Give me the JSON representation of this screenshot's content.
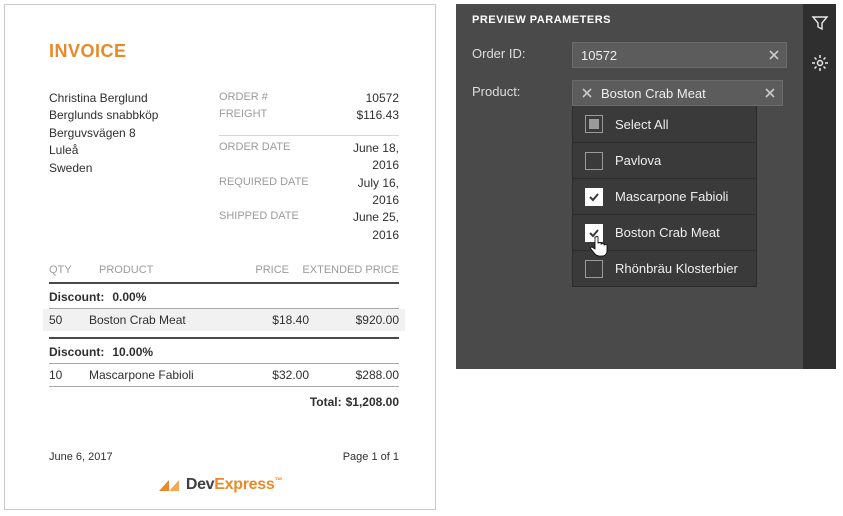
{
  "invoice": {
    "title": "INVOICE",
    "customer": {
      "name": "Christina Berglund",
      "company": "Berglunds snabbköp",
      "street": "Berguvsvägen 8",
      "city": "Luleå",
      "country": "Sweden"
    },
    "meta1": {
      "order_lbl": "ORDER #",
      "order_val": "10572",
      "freight_lbl": "FREIGHT",
      "freight_val": "$116.43"
    },
    "meta2": {
      "orderdate_lbl": "ORDER DATE",
      "orderdate_val": "June 18, 2016",
      "reqdate_lbl": "REQUIRED DATE",
      "reqdate_val": "July 16, 2016",
      "shipdate_lbl": "SHIPPED DATE",
      "shipdate_val": "June 25, 2016"
    },
    "cols": {
      "qty": "QTY",
      "product": "PRODUCT",
      "price": "PRICE",
      "ext": "EXTENDED PRICE"
    },
    "groups": [
      {
        "discount_label": "Discount:",
        "discount_val": "0.00%",
        "rows": [
          {
            "qty": "50",
            "name": "Boston Crab Meat",
            "price": "$18.40",
            "ext": "$920.00",
            "shaded": true
          }
        ]
      },
      {
        "discount_label": "Discount:",
        "discount_val": "10.00%",
        "rows": [
          {
            "qty": "10",
            "name": "Mascarpone Fabioli",
            "price": "$32.00",
            "ext": "$288.00"
          }
        ]
      }
    ],
    "total_label": "Total:",
    "total_val": "$1,208.00",
    "footer": {
      "date": "June 6, 2017",
      "page": "Page 1 of 1"
    },
    "brand": {
      "dev": "Dev",
      "express": "Express"
    }
  },
  "params": {
    "header": "PREVIEW PARAMETERS",
    "orderid_label": "Order ID:",
    "orderid_value": "10572",
    "product_label": "Product:",
    "tag_value": "Boston Crab Meat",
    "options": {
      "selectall": "Select All",
      "opt1": "Pavlova",
      "opt2": "Mascarpone Fabioli",
      "opt3": "Boston Crab Meat",
      "opt4": "Rhönbräu Klosterbier"
    }
  }
}
